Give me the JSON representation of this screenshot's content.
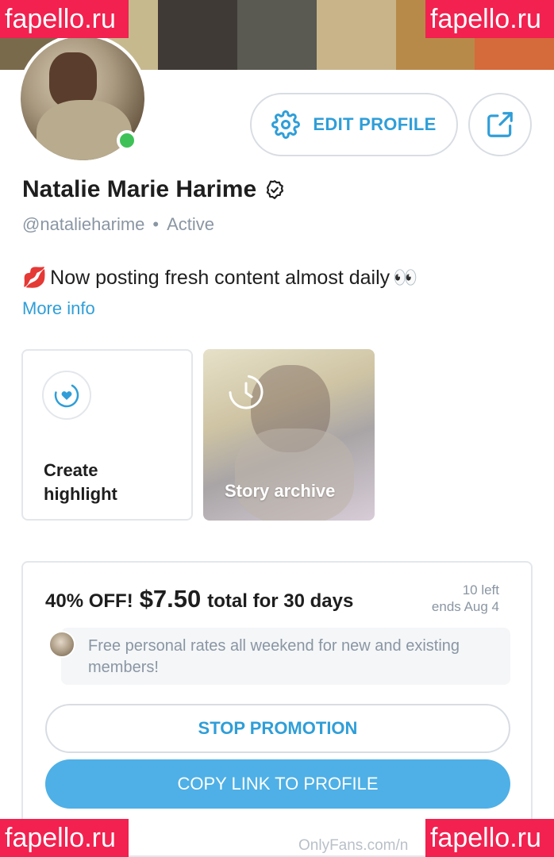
{
  "cover": {
    "tiles": [
      "#7a6a4c",
      "#c7b98e",
      "#403a36",
      "#5a5a52",
      "#c9b48a",
      "#b88a4a",
      "#d56a3a"
    ]
  },
  "watermark": {
    "text": "fapello.ru",
    "color": "#f2214f"
  },
  "profile": {
    "name": "Natalie Marie Harime",
    "handle": "@natalieharime",
    "separator": "•",
    "status": "Active",
    "bio_emoji_lips": "💋",
    "bio_text": "Now posting fresh content almost daily",
    "bio_emoji_eyes": "👀",
    "more_info": "More info"
  },
  "actions": {
    "edit_profile": "EDIT PROFILE"
  },
  "highlights": {
    "create_label": "Create highlight",
    "archive_label": "Story archive"
  },
  "promo": {
    "off": "40% OFF!",
    "price": "$7.50",
    "term": "total for 30 days",
    "left": "10 left",
    "ends": "ends Aug 4",
    "message": "Free personal rates all weekend for new and existing members!",
    "stop_label": "STOP PROMOTION",
    "copy_label": "COPY LINK TO PROFILE"
  },
  "footer": {
    "text": "OnlyFans.com/n"
  },
  "colors": {
    "accent": "#2f9ed8",
    "online": "#3ec257",
    "copy_button": "#4eb0e6",
    "muted": "#8a96a3"
  }
}
